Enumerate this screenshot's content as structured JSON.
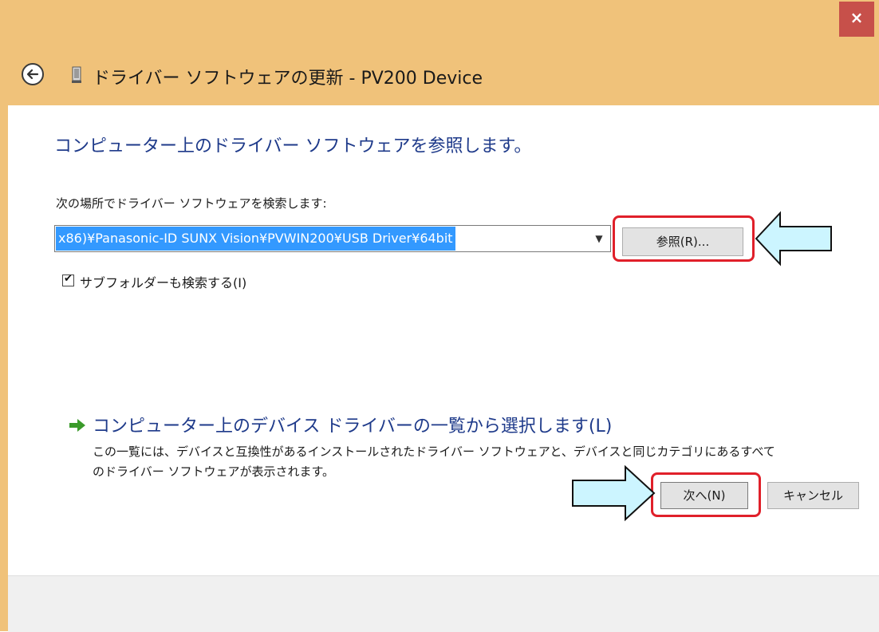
{
  "window": {
    "title": "ドライバー ソフトウェアの更新 - PV200 Device",
    "close_label": "×",
    "frame_color": "#f0c27a"
  },
  "main": {
    "heading": "コンピューター上のドライバー ソフトウェアを参照します。",
    "search_label": "次の場所でドライバー ソフトウェアを検索します:",
    "path_value": "x86)¥Panasonic-ID SUNX Vision¥PVWIN200¥USB Driver¥64bit",
    "browse_label": "参照(R)...",
    "subfolder_label": "サブフォルダーも検索する(I)",
    "subfolder_checked": true,
    "list_link_title": "コンピューター上のデバイス ドライバーの一覧から選択します(L)",
    "list_link_desc": "この一覧には、デバイスと互換性があるインストールされたドライバー ソフトウェアと、デバイスと同じカテゴリにあるすべてのドライバー ソフトウェアが表示されます。"
  },
  "footer": {
    "next_label": "次へ(N)",
    "cancel_label": "キャンセル"
  },
  "annotations": {
    "highlight_color": "#e0202a",
    "arrow_fill": "#ccf5ff"
  }
}
